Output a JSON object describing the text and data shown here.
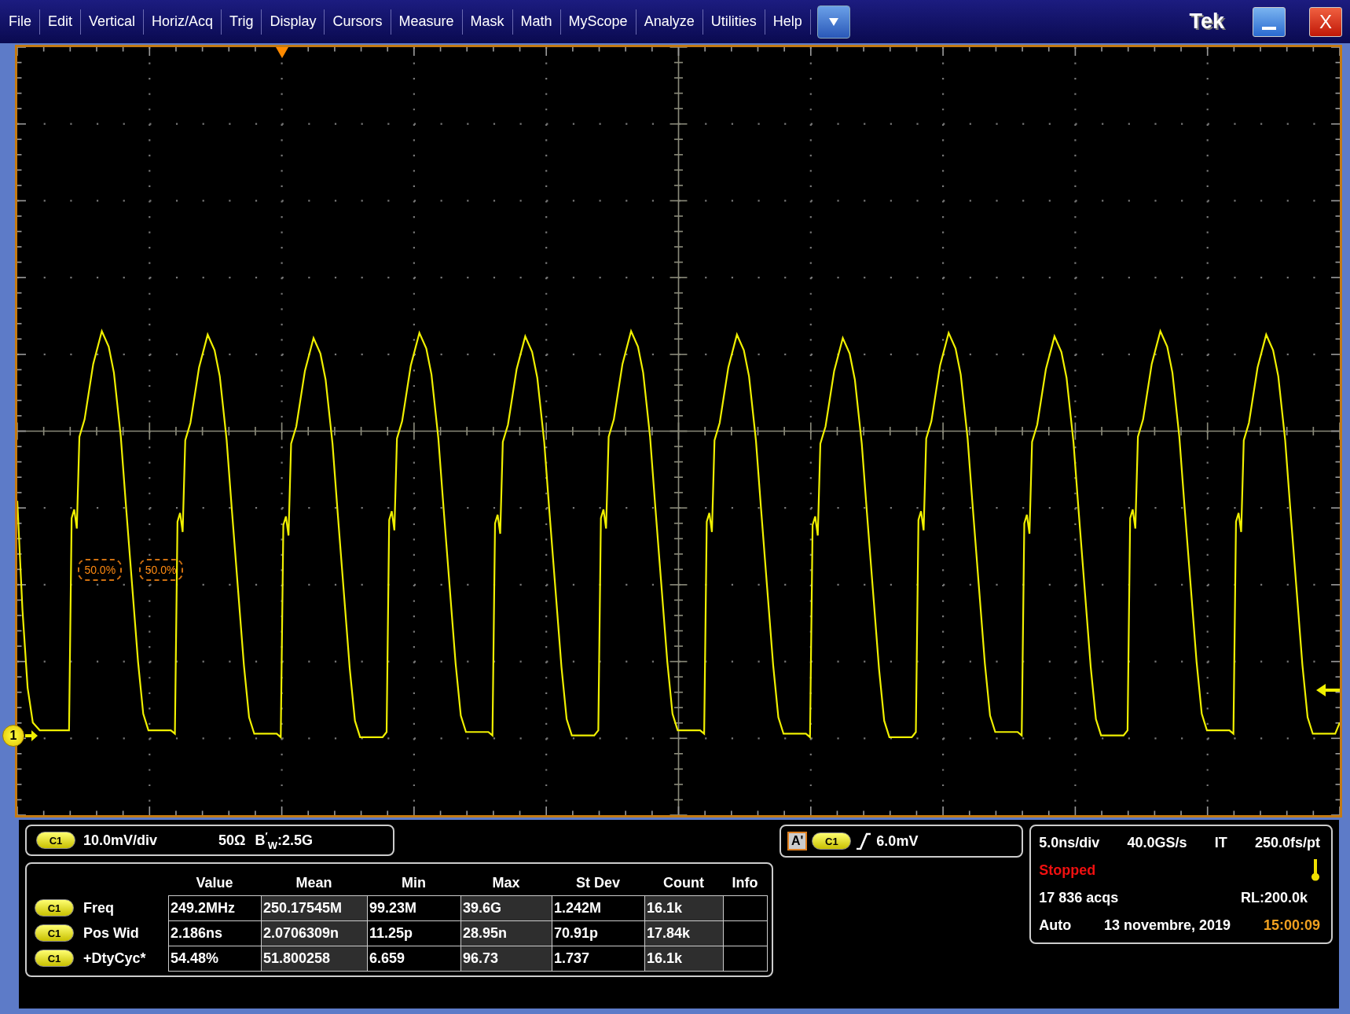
{
  "menu_bar": {
    "items": [
      "File",
      "Edit",
      "Vertical",
      "Horiz/Acq",
      "Trig",
      "Display",
      "Cursors",
      "Measure",
      "Mask",
      "Math",
      "MyScope",
      "Analyze",
      "Utilities",
      "Help"
    ],
    "brand": "Tek",
    "close_label": "X"
  },
  "display": {
    "channel_marker": "1",
    "measurement_labels": [
      "50.0%",
      "50.0%"
    ]
  },
  "channel_readout": {
    "channel": "C1",
    "scale": "10.0mV/div",
    "impedance": "50Ω",
    "bandwidth": "B$^{′}$$_{W}$:2.5G"
  },
  "measurements": {
    "columns": [
      "Value",
      "Mean",
      "Min",
      "Max",
      "St Dev",
      "Count",
      "Info"
    ],
    "rows": [
      {
        "source": "C1",
        "name": "Freq",
        "cells": [
          "249.2MHz",
          "250.17545M",
          "99.23M",
          "39.6G",
          "1.242M",
          "16.1k"
        ]
      },
      {
        "source": "C1",
        "name": "Pos Wid",
        "cells": [
          "2.186ns",
          "2.0706309n",
          "11.25p",
          "28.95n",
          "70.91p",
          "17.84k"
        ]
      },
      {
        "source": "C1",
        "name": "+DtyCyc*",
        "cells": [
          "54.48%",
          "51.800258",
          "6.659",
          "96.73",
          "1.737",
          "16.1k"
        ]
      }
    ]
  },
  "trigger": {
    "tag": "A'",
    "source": "C1",
    "level": "6.0mV"
  },
  "acquisition": {
    "time_scale": "5.0ns/div",
    "sample_rate": "40.0GS/s",
    "mode_code": "IT",
    "resolution": "250.0fs/pt",
    "status": "Stopped",
    "acqs": "17 836 acqs",
    "record_length": "RL:200.0k",
    "trigger_mode": "Auto",
    "date": "13 novembre, 2019",
    "time": "15:00:09"
  }
}
